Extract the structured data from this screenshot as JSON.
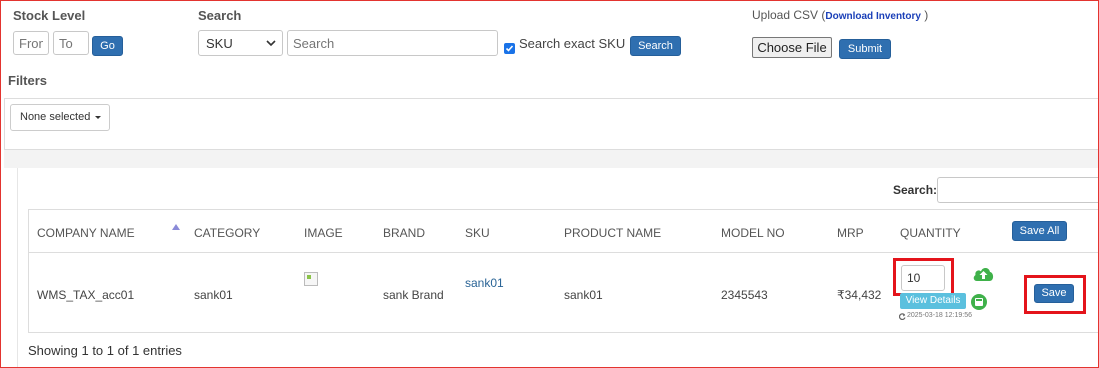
{
  "stock_level": {
    "label": "Stock Level",
    "from_placeholder": "From",
    "to_placeholder": "To",
    "go_label": "Go"
  },
  "search": {
    "label": "Search",
    "select_value": "SKU",
    "input_placeholder": "Search",
    "exact_label": "Search exact SKU",
    "button_label": "Search"
  },
  "upload": {
    "label": "Upload CSV",
    "paren_open": "(",
    "link_label": "Download Inventory",
    "paren_close": ")",
    "choose_file_label": "Choose File",
    "submit_label": "Submit"
  },
  "filters": {
    "label": "Filters",
    "dropdown_value": "None selected"
  },
  "table": {
    "search_label": "Search:",
    "headers": [
      "COMPANY NAME",
      "CATEGORY",
      "IMAGE",
      "BRAND",
      "SKU",
      "PRODUCT NAME",
      "MODEL NO",
      "MRP",
      "QUANTITY"
    ],
    "save_all_label": "Save All",
    "rows": [
      {
        "company": "WMS_TAX_acc01",
        "category": "sank01",
        "brand": "sank Brand",
        "sku": "sank01",
        "product": "sank01",
        "model": "2345543",
        "mrp": "₹34,432",
        "quantity": "10",
        "view_details": "View Details",
        "timestamp": "2025-03-18 12:19:56",
        "save_label": "Save"
      }
    ],
    "footer": "Showing 1 to 1 of 1 entries"
  },
  "colors": {
    "primary": "#2f6fb0",
    "info": "#5bc0de",
    "success": "#3fb14a",
    "highlight": "#e4141b"
  }
}
